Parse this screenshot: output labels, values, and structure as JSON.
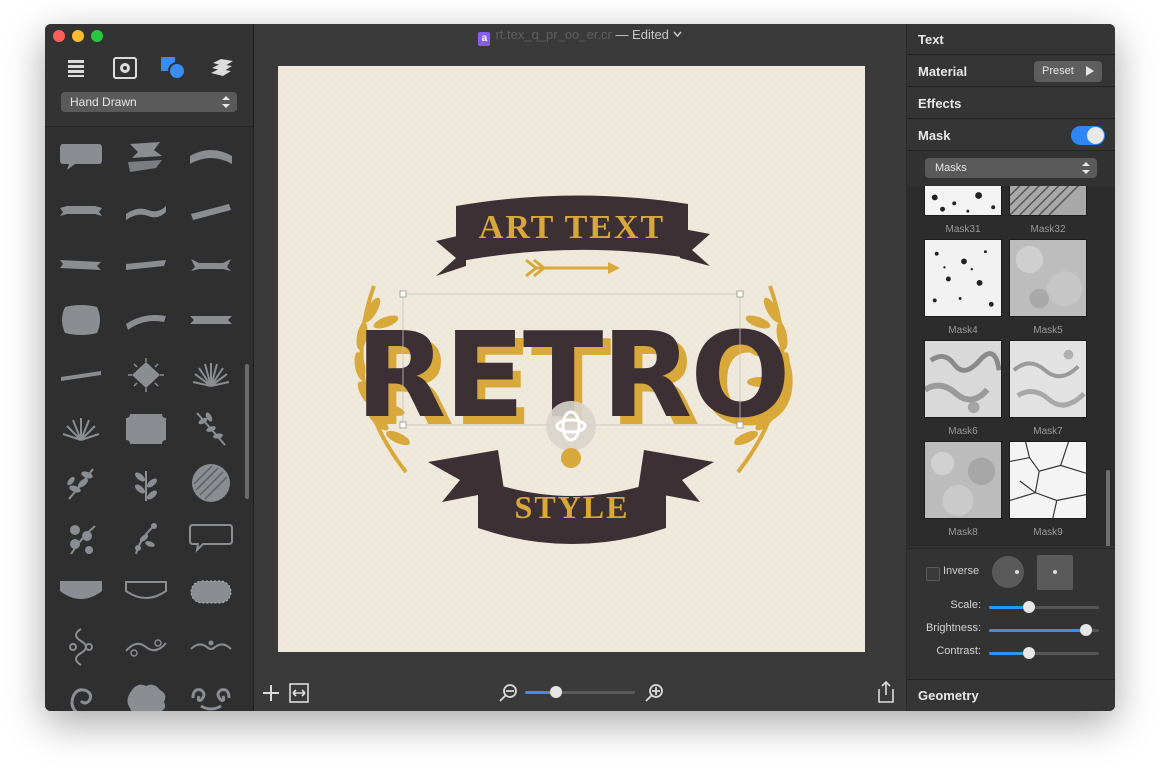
{
  "window": {
    "title_name": "rt.tex_q_pr_oo_er.cr",
    "title_status": "— Edited"
  },
  "sidebar": {
    "category": "Hand Drawn",
    "toolbar": [
      "list-icon",
      "gear-icon",
      "shapes-icon",
      "layers-icon"
    ]
  },
  "artwork": {
    "banner_top": "ART TEXT",
    "headline": "RETRO",
    "banner_bottom": "STYLE",
    "colors": {
      "dark": "#3c3035",
      "gold": "#d9a83a",
      "paper": "#efe9dc"
    }
  },
  "bottom_toolbar": {
    "zoom": 0.28
  },
  "inspector": {
    "sections": {
      "text": "Text",
      "material": "Material",
      "effects": "Effects",
      "mask": "Mask",
      "geometry": "Geometry"
    },
    "preset_label": "Preset",
    "mask_enabled": true,
    "mask_select": "Masks",
    "masks": [
      {
        "label": "Mask31"
      },
      {
        "label": "Mask32"
      },
      {
        "label": "Mask4"
      },
      {
        "label": "Mask5"
      },
      {
        "label": "Mask6"
      },
      {
        "label": "Mask7"
      },
      {
        "label": "Mask8"
      },
      {
        "label": "Mask9"
      }
    ],
    "inverse_label": "Inverse",
    "sliders": [
      {
        "label": "Scale:",
        "value": 0.36
      },
      {
        "label": "Brightness:",
        "value": 0.88
      },
      {
        "label": "Contrast:",
        "value": 0.36
      }
    ],
    "accent": "#3a8df2"
  }
}
